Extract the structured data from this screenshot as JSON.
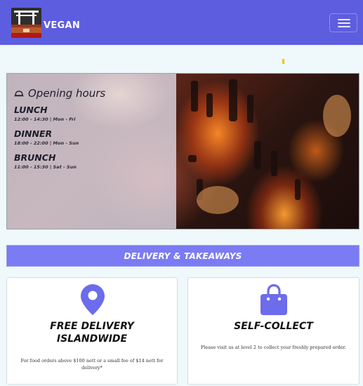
{
  "navbar": {
    "brand": "VEGAN",
    "logo_icon": "torii-gate-logo",
    "toggle_icon": "hamburger-menu-icon",
    "background": "#5d5de0"
  },
  "hero": {
    "title": "Opening hours",
    "title_icon": "bell-icon",
    "meals": [
      {
        "name": "LUNCH",
        "time": "12:00 - 14:30 | Mon - Fri"
      },
      {
        "name": "DINNER",
        "time": "18:00 - 22:00 | Mon - Sun"
      },
      {
        "name": "BRUNCH",
        "time": "11:00 - 15:30 | Sat - Sun"
      }
    ]
  },
  "delivery": {
    "heading": "DELIVERY & TAKEAWAYS",
    "accent": "#7b7bf4"
  },
  "cards": [
    {
      "icon": "map-pin-icon",
      "title_line1": "FREE  DELIVERY",
      "title_line2": "ISLANDWIDE",
      "text": "For food orders above $100 nett or a small fee of $14 nett for delivery*"
    },
    {
      "icon": "shopping-bag-icon",
      "title_line1": "SELF-COLLECT",
      "text": "Please visit us at level 2 to collect your freshly prepared order."
    }
  ]
}
